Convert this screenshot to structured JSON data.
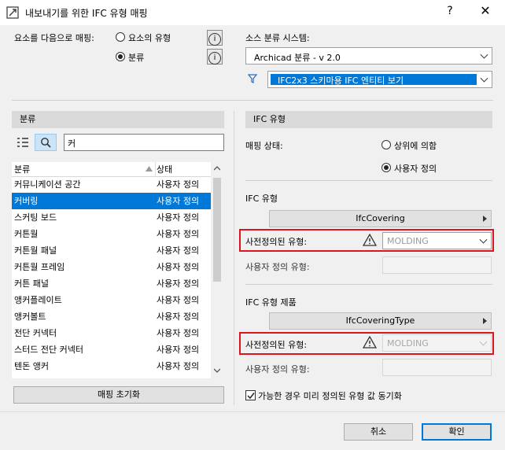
{
  "window": {
    "title": "내보내기를 위한 IFC 유형 매핑",
    "help": "?",
    "close": "✕"
  },
  "mapping": {
    "label": "요소를 다음으로 매핑:",
    "option1": "요소의 유형",
    "option2": "분류",
    "selected": "분류",
    "info_glyph": "i"
  },
  "source": {
    "label": "소스 분류 시스템:",
    "value": "Archicad 분류 - v 2.0",
    "filter_value": "IFC2x3 스키마용 IFC 엔티티 보기"
  },
  "left_panel": {
    "header": "분류",
    "search_value": "커",
    "columns": [
      "분류",
      "상태"
    ],
    "rows": [
      {
        "name": "커뮤니케이션 공간",
        "status": "사용자 정의"
      },
      {
        "name": "커버링",
        "status": "사용자 정의",
        "selected": true
      },
      {
        "name": "스커팅 보드",
        "status": "사용자 정의"
      },
      {
        "name": "커튼월",
        "status": "사용자 정의"
      },
      {
        "name": "커튼월 패널",
        "status": "사용자 정의"
      },
      {
        "name": "커튼월 프레임",
        "status": "사용자 정의"
      },
      {
        "name": "커튼 패널",
        "status": "사용자 정의"
      },
      {
        "name": "앵커플레이트",
        "status": "사용자 정의"
      },
      {
        "name": "앵커볼트",
        "status": "사용자 정의"
      },
      {
        "name": "전단 커넥터",
        "status": "사용자 정의"
      },
      {
        "name": "스터드 전단 커넥터",
        "status": "사용자 정의"
      },
      {
        "name": "텐돈 앵커",
        "status": "사용자 정의"
      }
    ],
    "reset_button": "매핑 초기화"
  },
  "right_panel": {
    "header": "IFC 유형",
    "status_label": "매핑 상태:",
    "status_option1": "상위에 의함",
    "status_option2": "사용자 정의",
    "status_selected": "사용자 정의",
    "ifc_type": {
      "label": "IFC 유형",
      "button": "IfcCovering",
      "predefined_label": "사전정의된 유형:",
      "predefined_value": "MOLDING",
      "user_label": "사용자 정의 유형:"
    },
    "ifc_product": {
      "label": "IFC 유형 제품",
      "button": "IfcCoveringType",
      "predefined_label": "사전정의된 유형:",
      "predefined_value": "MOLDING",
      "user_label": "사용자 정의 유형:"
    },
    "sync_checkbox": "가능한 경우 미리 정의된 유형 값 동기화",
    "sync_checked": true
  },
  "footer": {
    "cancel": "취소",
    "ok": "확인"
  },
  "colors": {
    "selection": "#0078d7",
    "highlight_border": "#e0141e",
    "warning": "#333333"
  }
}
